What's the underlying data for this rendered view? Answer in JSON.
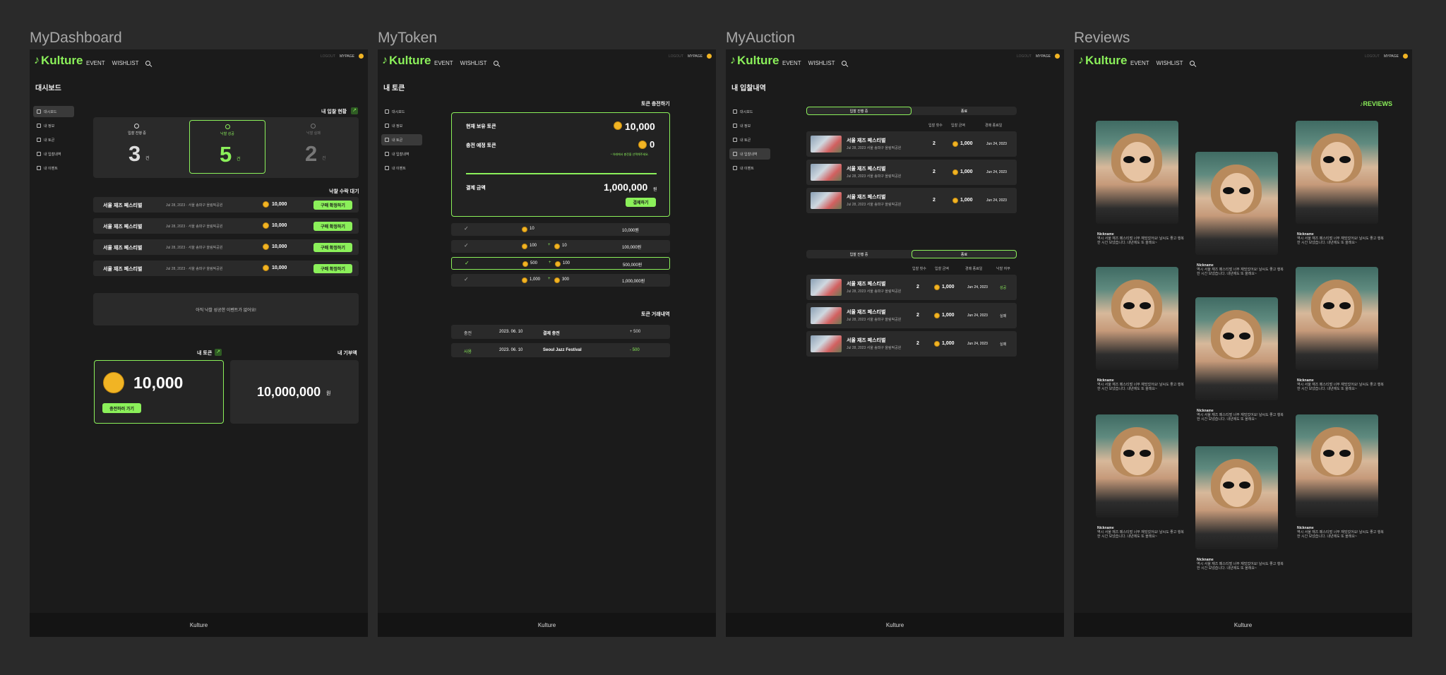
{
  "frames": {
    "dashboard": "MyDashboard",
    "token": "MyToken",
    "auction": "MyAuction",
    "reviews": "Reviews"
  },
  "topbar": {
    "logo": "Kulture",
    "nav": [
      "EVENT",
      "WISHLIST"
    ],
    "logout": "LOGOUT",
    "mypage": "MYPAGE"
  },
  "sidebar": [
    "대시보드",
    "내 정보",
    "내 토큰",
    "내 입찰내역",
    "내 이벤트"
  ],
  "footer": "Kulture",
  "dashboard": {
    "title": "대시보드",
    "status_title": "내 입찰 현황",
    "stats": [
      {
        "label": "입찰 진행 중",
        "value": "3",
        "unit": "건"
      },
      {
        "label": "낙찰 성공",
        "value": "5",
        "unit": "건"
      },
      {
        "label": "낙찰 실패",
        "value": "2",
        "unit": "건"
      }
    ],
    "pending_title": "낙찰 수락 대기",
    "pending": [
      {
        "name": "서울 재즈 페스티벌",
        "info": "Jul 28, 2023 · 서울 송파구 올림픽공원",
        "amount": "10,000",
        "btn": "구매 확정하기"
      },
      {
        "name": "서울 재즈 페스티벌",
        "info": "Jul 28, 2023 · 서울 송파구 올림픽공원",
        "amount": "10,000",
        "btn": "구매 확정하기"
      },
      {
        "name": "서울 재즈 페스티벌",
        "info": "Jul 28, 2023 · 서울 송파구 올림픽공원",
        "amount": "10,000",
        "btn": "구매 확정하기"
      },
      {
        "name": "서울 재즈 페스티벌",
        "info": "Jul 28, 2023 · 서울 송파구 올림픽공원",
        "amount": "10,000",
        "btn": "구매 확정하기"
      }
    ],
    "empty_msg": "아직 낙찰 성공한 이벤트가 없어요!",
    "token_title": "내 토큰",
    "token_value": "10,000",
    "token_btn": "충전하러 가기",
    "donation_title": "내 기부액",
    "donation_value": "10,000,000",
    "donation_unit": "원"
  },
  "token": {
    "title": "내 토큰",
    "charge_title": "토큰 충전하기",
    "held_label": "현재 보유 토큰",
    "held_value": "10,000",
    "charge_label": "충전 예정 토큰",
    "charge_value": "0",
    "hint": "* 아래에서 충전을 선택해주세요.",
    "pay_label": "결제 금액",
    "pay_value": "1,000,000",
    "pay_unit": "원",
    "pay_btn": "결제하기",
    "options": [
      {
        "base": "10",
        "bonus": "",
        "price": "10,000원"
      },
      {
        "base": "100",
        "bonus": "10",
        "price": "100,000원"
      },
      {
        "base": "500",
        "bonus": "100",
        "price": "500,000원"
      },
      {
        "base": "1,000",
        "bonus": "300",
        "price": "1,000,000원"
      }
    ],
    "history_title": "토큰 거래내역",
    "history": [
      {
        "type": "충전",
        "date": "2023. 06. 10",
        "desc": "결제 충전",
        "amount": "+ 500"
      },
      {
        "type": "사용",
        "date": "2023. 06. 10",
        "desc": "Seoul Jazz Festival",
        "amount": "- 500"
      }
    ]
  },
  "auction": {
    "title": "내 입찰내역",
    "tabs1": [
      "입찰 진행 중",
      "종료"
    ],
    "head1": [
      "입찰 횟수",
      "입찰 금액",
      "경매 종료일"
    ],
    "rows1": [
      {
        "name": "서울 재즈 페스티벌",
        "info": "Jul 28, 2023 서울 송파구 올림픽공원",
        "count": "2",
        "amount": "1,000",
        "date": "Jun 24, 2023"
      },
      {
        "name": "서울 재즈 페스티벌",
        "info": "Jul 28, 2023 서울 송파구 올림픽공원",
        "count": "2",
        "amount": "1,000",
        "date": "Jun 24, 2023"
      },
      {
        "name": "서울 재즈 페스티벌",
        "info": "Jul 28, 2023 서울 송파구 올림픽공원",
        "count": "2",
        "amount": "1,000",
        "date": "Jun 24, 2023"
      }
    ],
    "tabs2": [
      "입찰 진행 중",
      "종료"
    ],
    "head2": [
      "입찰 횟수",
      "입찰 금액",
      "경매 종료일",
      "낙찰 여부"
    ],
    "rows2": [
      {
        "name": "서울 재즈 페스티벌",
        "info": "Jul 28, 2023 서울 송파구 올림픽공원",
        "count": "2",
        "amount": "1,000",
        "date": "Jun 24, 2023",
        "result": "성공",
        "win": true
      },
      {
        "name": "서울 재즈 페스티벌",
        "info": "Jul 28, 2023 서울 송파구 올림픽공원",
        "count": "2",
        "amount": "1,000",
        "date": "Jun 24, 2023",
        "result": "실패",
        "win": false
      },
      {
        "name": "서울 재즈 페스티벌",
        "info": "Jul 28, 2023 서울 송파구 올림픽공원",
        "count": "2",
        "amount": "1,000",
        "date": "Jun 24, 2023",
        "result": "실패",
        "win": false
      }
    ]
  },
  "reviews": {
    "title": "REVIEWS",
    "nickname": "Nickname",
    "text": "역시 서울 재즈 페스티벌 너무 재밌었어요! 날씨도 좋고 행복한 시간 보냈습니다. 내년에도 또 올래요~"
  }
}
